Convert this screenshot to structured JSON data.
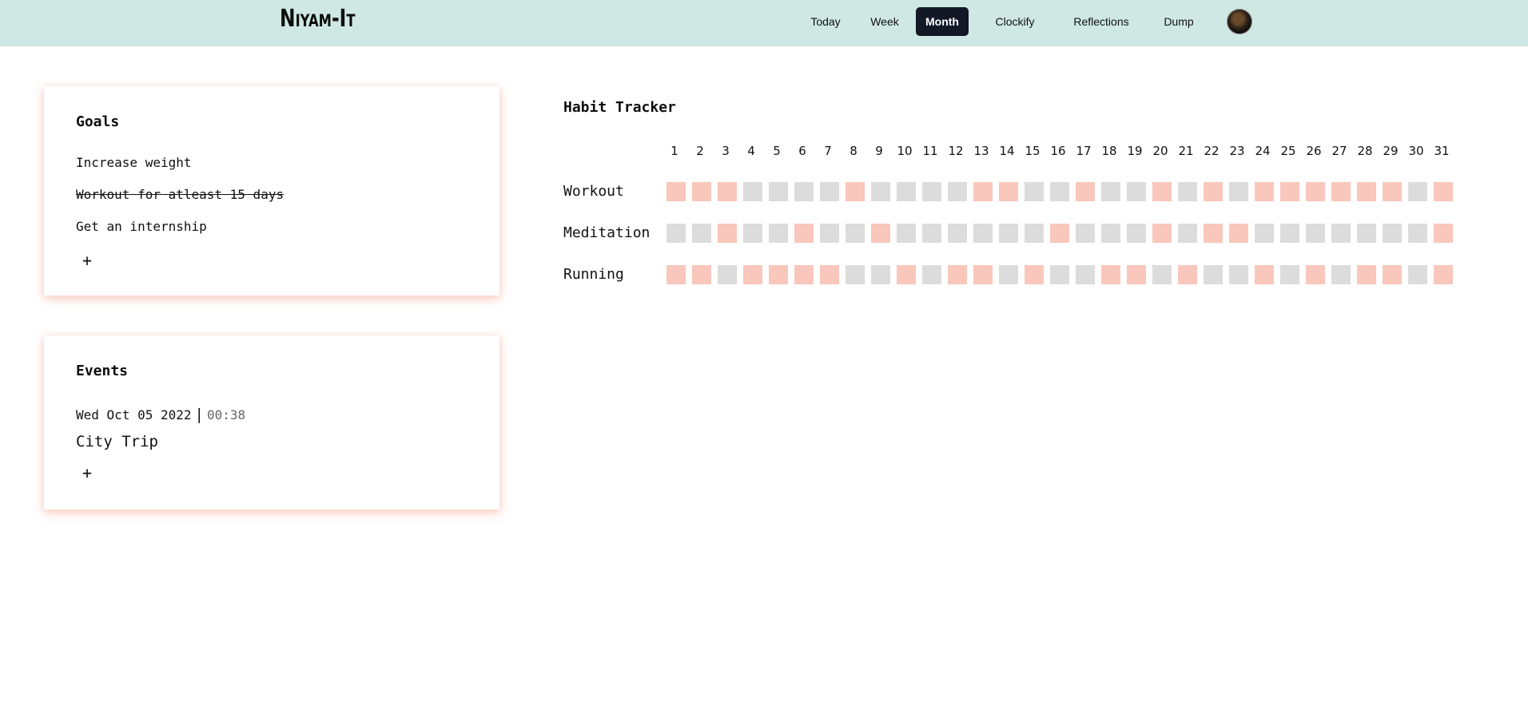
{
  "brand": "Niyam-It",
  "nav": [
    {
      "label": "Today",
      "name": "nav-today",
      "active": false
    },
    {
      "label": "Week",
      "name": "nav-week",
      "active": false
    },
    {
      "label": "Month",
      "name": "nav-month",
      "active": true
    },
    {
      "label": "Clockify",
      "name": "nav-clockify",
      "active": false
    },
    {
      "label": "Reflections",
      "name": "nav-reflections",
      "active": false
    },
    {
      "label": "Dump",
      "name": "nav-dump",
      "active": false
    }
  ],
  "goals": {
    "title": "Goals",
    "items": [
      {
        "text": "Increase weight",
        "done": false
      },
      {
        "text": "Workout for atleast 15 days",
        "done": true
      },
      {
        "text": "Get an internship",
        "done": false
      }
    ],
    "add_label": "+"
  },
  "events": {
    "title": "Events",
    "items": [
      {
        "date": "Wed Oct 05 2022",
        "separator": "|",
        "time": "00:38",
        "name": "City Trip"
      }
    ],
    "add_label": "+"
  },
  "habit_tracker": {
    "title": "Habit Tracker",
    "days": [
      "1",
      "2",
      "3",
      "4",
      "5",
      "6",
      "7",
      "8",
      "9",
      "10",
      "11",
      "12",
      "13",
      "14",
      "15",
      "16",
      "17",
      "18",
      "19",
      "20",
      "21",
      "22",
      "23",
      "24",
      "25",
      "26",
      "27",
      "28",
      "29",
      "30",
      "31"
    ],
    "habits": [
      {
        "name": "Workout",
        "done": [
          1,
          1,
          1,
          0,
          0,
          0,
          0,
          1,
          0,
          0,
          0,
          0,
          1,
          1,
          0,
          0,
          1,
          0,
          0,
          1,
          0,
          1,
          0,
          1,
          1,
          1,
          1,
          1,
          1,
          0,
          1
        ]
      },
      {
        "name": "Meditation",
        "done": [
          0,
          0,
          1,
          0,
          0,
          1,
          0,
          0,
          1,
          0,
          0,
          0,
          0,
          0,
          0,
          1,
          0,
          0,
          0,
          1,
          0,
          1,
          1,
          0,
          0,
          0,
          0,
          0,
          0,
          0,
          1
        ]
      },
      {
        "name": "Running",
        "done": [
          1,
          1,
          0,
          1,
          1,
          1,
          1,
          0,
          0,
          1,
          0,
          1,
          1,
          0,
          1,
          0,
          0,
          1,
          1,
          0,
          1,
          0,
          0,
          1,
          0,
          1,
          0,
          1,
          1,
          0,
          1
        ]
      }
    ],
    "colors": {
      "done": "#f9c7bb",
      "not_done": "#dcdcdc"
    }
  }
}
